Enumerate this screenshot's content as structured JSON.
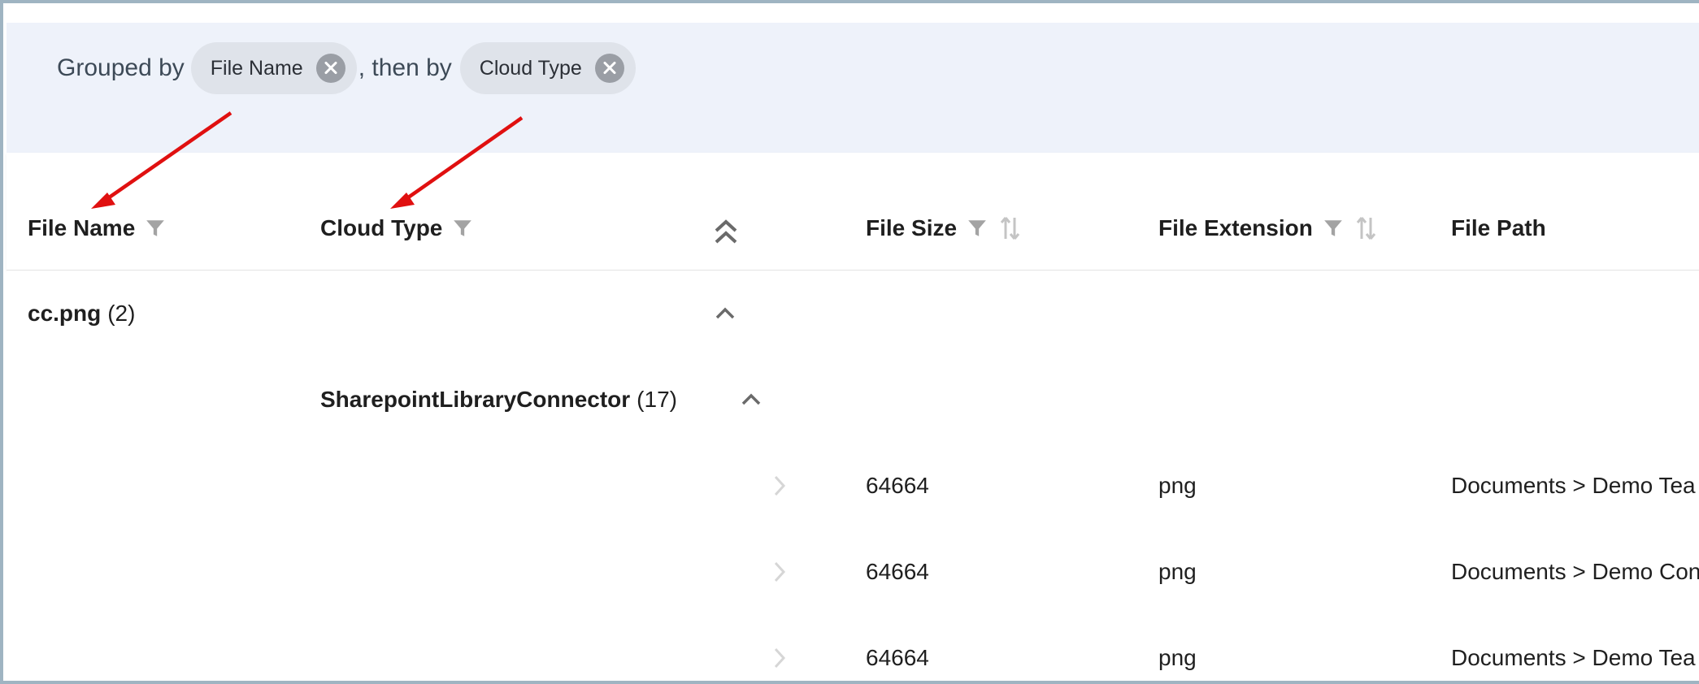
{
  "grouping": {
    "prefix": "Grouped by",
    "separator": ", then by",
    "chips": [
      {
        "label": "File Name"
      },
      {
        "label": "Cloud Type"
      }
    ]
  },
  "columns": {
    "file_name": "File Name",
    "cloud_type": "Cloud Type",
    "file_size": "File Size",
    "file_extension": "File Extension",
    "file_path": "File Path"
  },
  "groups": [
    {
      "name": "cc.png",
      "count": "(2)",
      "subgroups": [
        {
          "name": "SharepointLibraryConnector",
          "count": "(17)",
          "rows": [
            {
              "size": "64664",
              "ext": "png",
              "path": "Documents > Demo Tea"
            },
            {
              "size": "64664",
              "ext": "png",
              "path": "Documents > Demo Con"
            },
            {
              "size": "64664",
              "ext": "png",
              "path": "Documents > Demo Tea"
            }
          ]
        }
      ]
    }
  ],
  "colors": {
    "group_bar_bg": "#eef2fa",
    "chip_bg": "#dfe3ea",
    "annotation_arrow": "#e01010",
    "icon_gray": "#9a9a9a"
  }
}
